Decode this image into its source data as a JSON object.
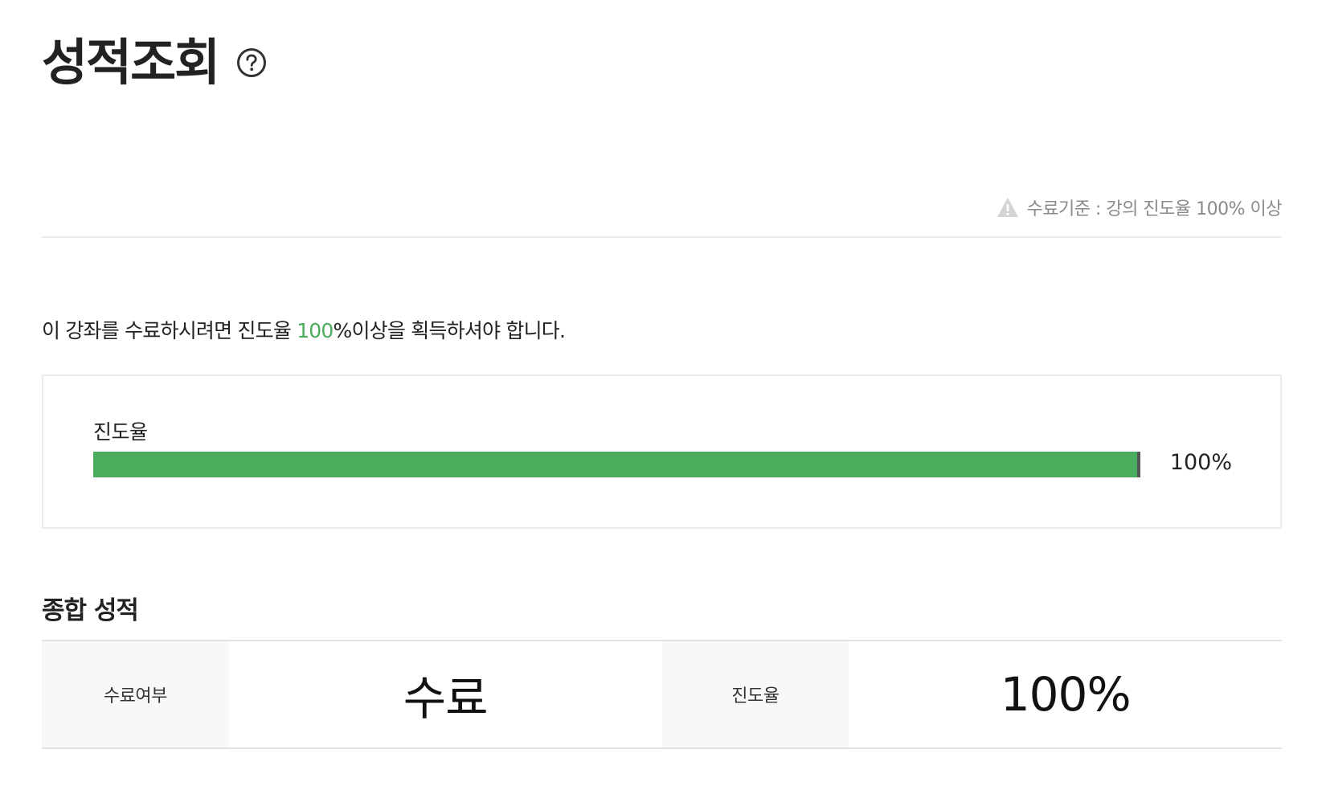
{
  "header": {
    "title": "성적조회",
    "help_icon": "question-circle-icon"
  },
  "criteria": {
    "icon": "warning-triangle-icon",
    "text": "수료기준 : 강의 진도율 100% 이상"
  },
  "notice": {
    "before": "이 강좌를 수료하시려면 진도율 ",
    "highlight": "100",
    "after": "%이상을 획득하셔야 합니다.",
    "accent_color": "#4cac5e"
  },
  "progress": {
    "label": "진도율",
    "value_text": "100%",
    "fraction": 1.0,
    "bar_color": "#4cac5e"
  },
  "summary": {
    "title": "종합 성적",
    "completion_label": "수료여부",
    "completion_value": "수료",
    "progress_label": "진도율",
    "progress_value": "100%"
  }
}
